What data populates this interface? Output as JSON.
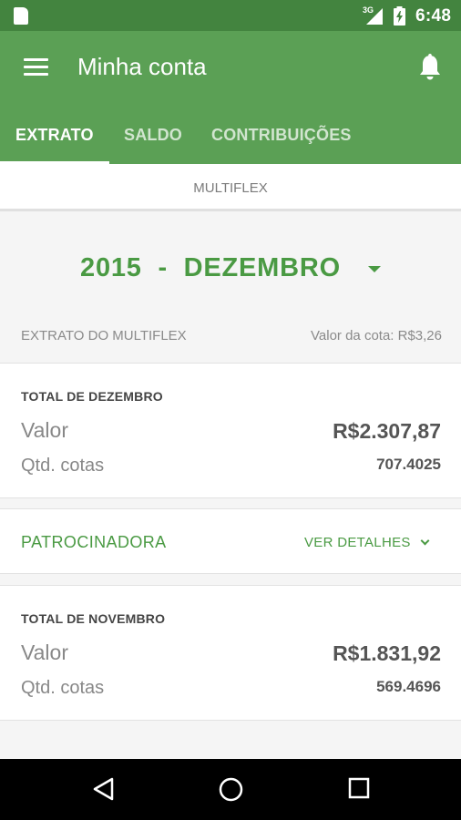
{
  "status_bar": {
    "network_type": "3G",
    "time": "6:48",
    "icons": [
      "sd-card-icon",
      "signal-icon",
      "battery-icon"
    ]
  },
  "app_bar": {
    "title": "Minha conta",
    "icons": [
      "menu-icon",
      "bell-icon"
    ],
    "tabs": [
      {
        "label": "EXTRATO",
        "active": true
      },
      {
        "label": "SALDO",
        "active": false
      },
      {
        "label": "CONTRIBUIÇÕES",
        "active": false
      }
    ]
  },
  "fund": {
    "name": "MULTIFLEX"
  },
  "period": {
    "label": "2015  -  DEZEMBRO"
  },
  "extrato": {
    "header_left": "EXTRATO DO MULTIFLEX",
    "header_right": "Valor da cota: R$3,26"
  },
  "months": [
    {
      "title": "TOTAL DE DEZEMBRO",
      "valor_label": "Valor",
      "valor": "R$2.307,87",
      "cotas_label": "Qtd. cotas",
      "cotas": "707.4025"
    },
    {
      "title": "TOTAL DE NOVEMBRO",
      "valor_label": "Valor",
      "valor": "R$1.831,92",
      "cotas_label": "Qtd. cotas",
      "cotas": "569.4696"
    }
  ],
  "sponsor": {
    "label": "PATROCINADORA",
    "details_label": "VER DETALHES"
  },
  "nav_bar": {
    "buttons": [
      "back-icon",
      "home-icon",
      "recents-icon"
    ]
  },
  "colors": {
    "status_bar": "#43843f",
    "app_bar": "#5ba055",
    "accent_green": "#4a9a43",
    "background": "#f5f5f5"
  }
}
